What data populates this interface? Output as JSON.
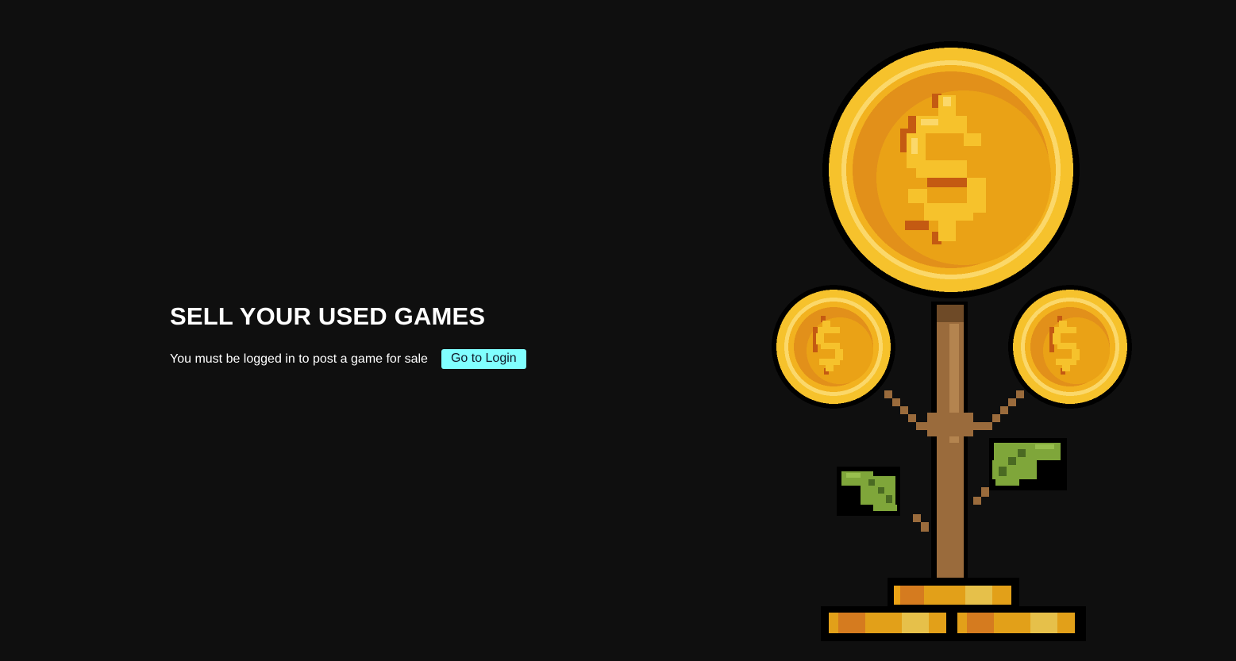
{
  "sell_section": {
    "heading": "SELL YOUR USED GAMES",
    "login_message": "You must be logged in to post a game for sale",
    "login_button_label": "Go to Login"
  },
  "illustration": {
    "icon": "money-tree-icon"
  },
  "colors": {
    "background": "#0f0f0f",
    "heading_text": "#ffffff",
    "button_background": "#80ffff",
    "button_text": "#111a2a",
    "coin_gold": "#eda013",
    "coin_light": "#fdde72",
    "coin_dark": "#c45a12",
    "stem": "#9a6b3c",
    "leaf": "#7fa63a"
  }
}
